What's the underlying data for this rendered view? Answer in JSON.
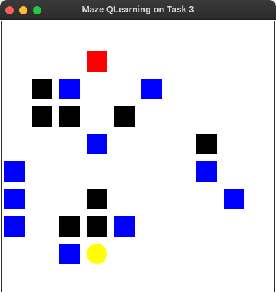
{
  "window": {
    "title": "Maze QLearning on Task 3"
  },
  "colors": {
    "goal": "#ff0000",
    "wall": "#000000",
    "trap": "#0000ff",
    "agent": "#ffff00",
    "background": "#ffffff"
  },
  "maze": {
    "goal": [
      {
        "col": 3,
        "row": 1
      }
    ],
    "walls": [
      {
        "col": 1,
        "row": 2
      },
      {
        "col": 1,
        "row": 3
      },
      {
        "col": 2,
        "row": 3
      },
      {
        "col": 4,
        "row": 3
      },
      {
        "col": 7,
        "row": 4
      },
      {
        "col": 3,
        "row": 6
      },
      {
        "col": 2,
        "row": 7
      },
      {
        "col": 3,
        "row": 7
      }
    ],
    "traps": [
      {
        "col": 2,
        "row": 2
      },
      {
        "col": 5,
        "row": 2
      },
      {
        "col": 3,
        "row": 4
      },
      {
        "col": 0,
        "row": 5
      },
      {
        "col": 7,
        "row": 5
      },
      {
        "col": 0,
        "row": 6
      },
      {
        "col": 8,
        "row": 6
      },
      {
        "col": 0,
        "row": 7
      },
      {
        "col": 4,
        "row": 7
      },
      {
        "col": 2,
        "row": 8
      }
    ],
    "agent": {
      "col": 3,
      "row": 8
    }
  }
}
